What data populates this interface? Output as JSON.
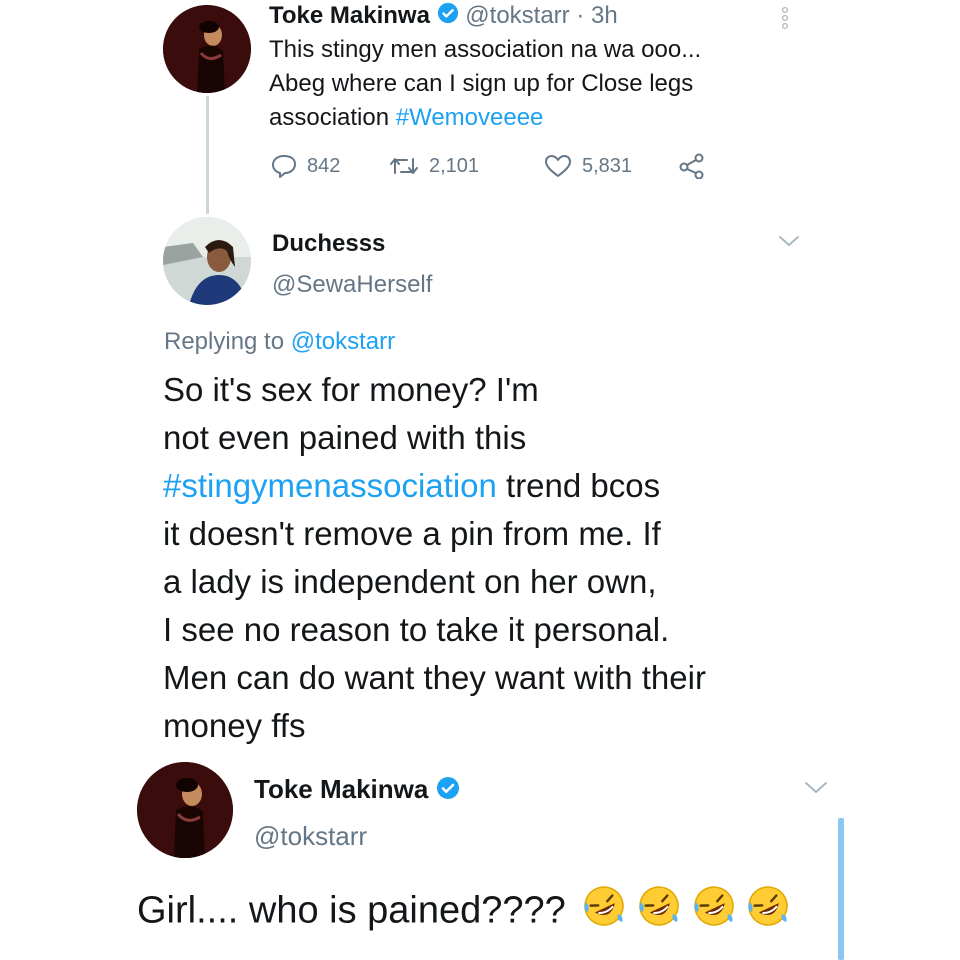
{
  "colors": {
    "accent": "#1da1f2",
    "text": "#14171a",
    "secondary": "#657786",
    "thread_line": "#ccd6dd"
  },
  "tweet1": {
    "name": "Toke Makinwa",
    "verified": true,
    "handle": "@tokstarr",
    "time": "· 3h",
    "text_line1": "This stingy men association na wa ooo...",
    "text_line2": "Abeg where can I sign up for Close legs",
    "text_line3_plain": "association ",
    "hashtag": "#Wemoveeee",
    "replies": "842",
    "retweets": "2,101",
    "likes": "5,831",
    "icons": [
      "more-vertical-icon",
      "reply-icon",
      "retweet-icon",
      "heart-icon",
      "share-icon"
    ]
  },
  "tweet2": {
    "name": "Duchesss",
    "handle": "@SewaHerself",
    "replying_label": "Replying to ",
    "replying_handle": "@tokstarr",
    "lines": [
      "So it's sex for money? I'm",
      "not even pained with this",
      " trend bcos",
      "it doesn't remove a pin from me. If",
      "a lady is independent on her own,",
      "I see no reason to take it personal.",
      "Men can do want they want with their",
      "money ffs"
    ],
    "hashtag": "#stingymenassociation",
    "icons": [
      "chevron-down-icon"
    ]
  },
  "tweet3": {
    "name": "Toke Makinwa",
    "verified": true,
    "handle": "@tokstarr",
    "text": "Girl.... who is pained????",
    "emoji": "rolling-on-floor-laughing",
    "emoji_count": 4,
    "icons": [
      "chevron-down-icon"
    ]
  }
}
